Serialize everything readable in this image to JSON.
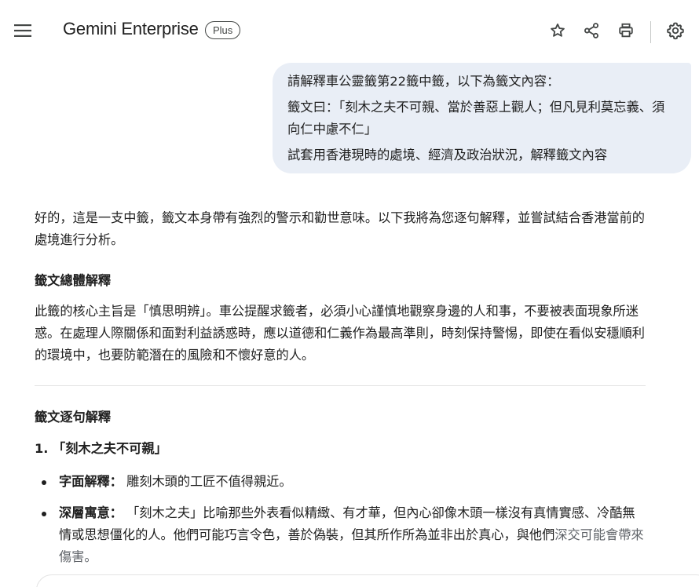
{
  "header": {
    "menu_icon": "hamburger-menu-icon",
    "title": "Gemini Enterprise",
    "badge": "Plus",
    "actions": [
      {
        "name": "star-icon"
      },
      {
        "name": "share-icon"
      },
      {
        "name": "print-icon"
      },
      {
        "name": "settings-gear-icon"
      }
    ]
  },
  "user_message": {
    "line1": "請解釋車公靈籤第22籤中籤，以下為籤文內容：",
    "line2": "籤文曰：「刻木之夫不可親、當於善惡上觀人；但凡見利莫忘義、須向仁中慮不仁」",
    "line3": "試套用香港現時的處境、經濟及政治狀況，解釋籤文內容"
  },
  "response": {
    "intro": "好的，這是一支中籤，籤文本身帶有強烈的警示和勸世意味。以下我將為您逐句解釋，並嘗試結合香港當前的處境進行分析。",
    "overall_heading": "籤文總體解釋",
    "overall_text": "此籤的核心主旨是「慎思明辨」。車公提醒求籤者，必須小心謹慎地觀察身邊的人和事，不要被表面現象所迷惑。在處理人際關係和面對利益誘惑時，應以道德和仁義作為最高準則，時刻保持警惕，即使在看似安穩順利的環境中，也要防範潛在的風險和不懷好意的人。",
    "lines_heading": "籤文逐句解釋",
    "item1_heading": "1. 「刻木之夫不可親」",
    "item1_bullets": [
      {
        "label": "字面解釋：",
        "text": "雕刻木頭的工匠不值得親近。",
        "text_faded": ""
      },
      {
        "label": "深層寓意：",
        "text": "「刻木之夫」比喻那些外表看似精緻、有才華，但內心卻像木頭一樣沒有真情實感、冷酷無情或思想僵化的人。他們可能巧言令色，善於偽裝，但其所作所為並非出於真心，與他們",
        "text_faded": "深交可能會帶來傷害。"
      }
    ]
  },
  "colors": {
    "user_bubble_bg": "#e9eef6",
    "text": "#1f1f1f",
    "icon": "#444746"
  }
}
